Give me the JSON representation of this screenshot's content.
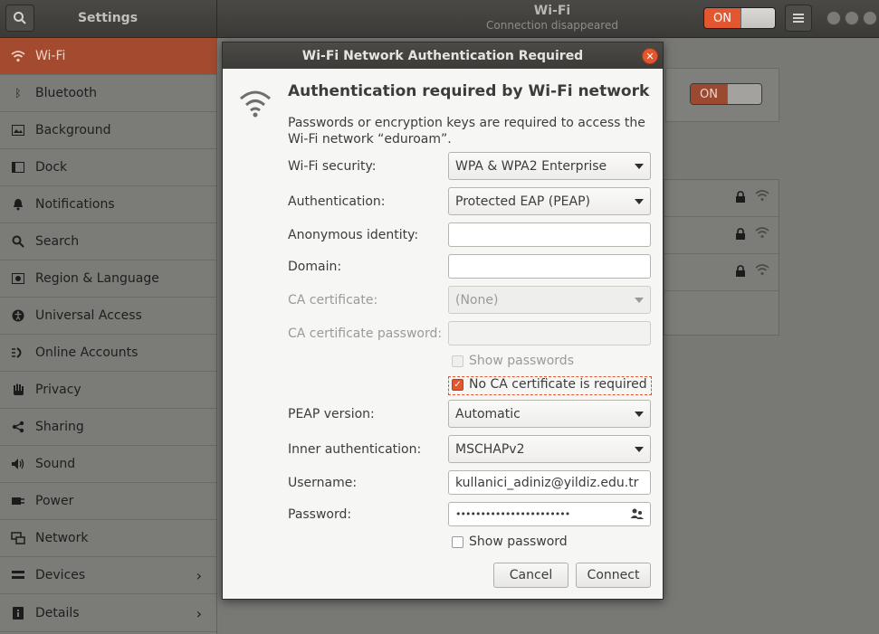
{
  "header": {
    "settings_title": "Settings",
    "title": "Wi-Fi",
    "subtitle": "Connection disappeared",
    "switch_label": "ON"
  },
  "sidebar": {
    "items": [
      {
        "label": "Wi-Fi",
        "icon": "wifi-icon"
      },
      {
        "label": "Bluetooth",
        "icon": "bluetooth-icon"
      },
      {
        "label": "Background",
        "icon": "background-icon"
      },
      {
        "label": "Dock",
        "icon": "dock-icon"
      },
      {
        "label": "Notifications",
        "icon": "bell-icon"
      },
      {
        "label": "Search",
        "icon": "search-icon"
      },
      {
        "label": "Region & Language",
        "icon": "region-icon"
      },
      {
        "label": "Universal Access",
        "icon": "accessibility-icon"
      },
      {
        "label": "Online Accounts",
        "icon": "online-accounts-icon"
      },
      {
        "label": "Privacy",
        "icon": "hand-icon"
      },
      {
        "label": "Sharing",
        "icon": "share-icon"
      },
      {
        "label": "Sound",
        "icon": "speaker-icon"
      },
      {
        "label": "Power",
        "icon": "power-icon"
      },
      {
        "label": "Network",
        "icon": "network-icon"
      },
      {
        "label": "Devices",
        "icon": "devices-icon"
      },
      {
        "label": "Details",
        "icon": "info-icon"
      }
    ],
    "active_index": 0
  },
  "main": {
    "wifi_switch_label": "ON"
  },
  "dialog": {
    "title": "Wi-Fi Network Authentication Required",
    "heading": "Authentication required by Wi-Fi network",
    "description": "Passwords or encryption keys are required to access the Wi-Fi network “eduroam”.",
    "wifi_security_label": "Wi-Fi security:",
    "wifi_security_value": "WPA & WPA2 Enterprise",
    "authentication_label": "Authentication:",
    "authentication_value": "Protected EAP (PEAP)",
    "anonymous_identity_label": "Anonymous identity:",
    "anonymous_identity_value": "",
    "domain_label": "Domain:",
    "domain_value": "",
    "ca_certificate_label": "CA certificate:",
    "ca_certificate_value": "(None)",
    "ca_password_label": "CA certificate password:",
    "ca_password_value": "",
    "show_passwords_label": "Show passwords",
    "no_ca_label": "No CA certificate is required",
    "no_ca_checked": true,
    "peap_version_label": "PEAP version:",
    "peap_version_value": "Automatic",
    "inner_auth_label": "Inner authentication:",
    "inner_auth_value": "MSCHAPv2",
    "username_label": "Username:",
    "username_value": "kullanici_adiniz@yildiz.edu.tr",
    "password_label": "Password:",
    "password_value": "•••••••••••••••••••••••",
    "show_password_label": "Show password",
    "cancel_label": "Cancel",
    "connect_label": "Connect"
  },
  "colors": {
    "accent": "#e2572f",
    "sidebar_active": "#a34a2f"
  }
}
